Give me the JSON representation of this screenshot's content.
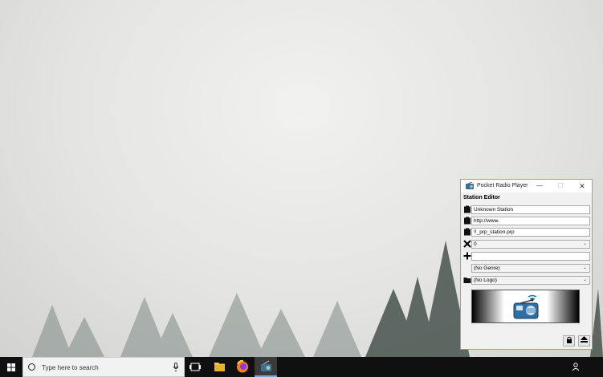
{
  "window": {
    "title": "Pocket Radio Player",
    "section_title": "Station Editor",
    "fields": {
      "station_name": "Unknown Station",
      "station_url": "http://www.",
      "station_file": "!!_prp_station.prp",
      "number_select": "0",
      "add_input": "",
      "genre_select": "(No Genre)",
      "logo_select": "(No Logo)"
    },
    "controls": {
      "minimize": "—",
      "maximize": "☐",
      "close": "✕"
    }
  },
  "taskbar": {
    "search_placeholder": "Type here to search"
  },
  "icons": {
    "app": "radio-icon",
    "field1": "clipboard-icon",
    "field2": "clipboard-icon",
    "field3": "clipboard-icon",
    "delete": "x-icon",
    "add": "plus-icon",
    "logo": "folder-icon",
    "lock": "lock-icon",
    "eject": "eject-icon"
  },
  "colors": {
    "window_border": "#7aa7d6",
    "taskbar": "#101010",
    "radio_body": "#2f6fa5"
  }
}
